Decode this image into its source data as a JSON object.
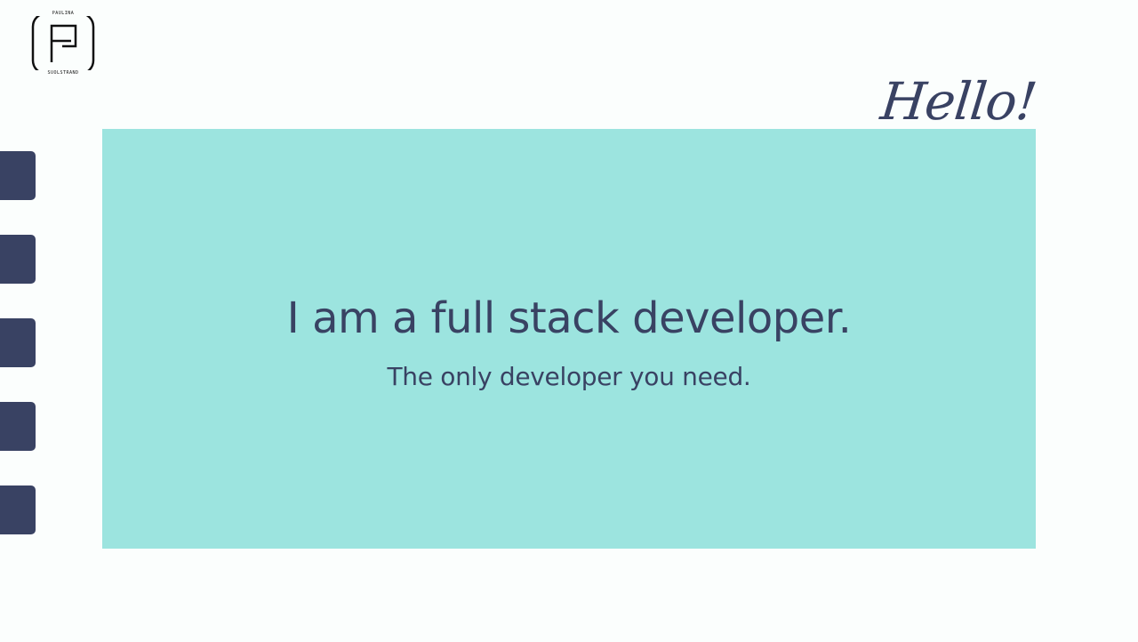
{
  "logo": {
    "top_text": "PAULINA",
    "bottom_text": "SUOLSTRAND",
    "icon": "pf-monogram-icon"
  },
  "greeting": "Hello!",
  "side_nav": {
    "item_count": 5,
    "color": "#394263"
  },
  "hero": {
    "title": "I am a full stack developer.",
    "subtitle": "The only developer you need.",
    "background": "#9ce4df",
    "text_color": "#394263"
  }
}
